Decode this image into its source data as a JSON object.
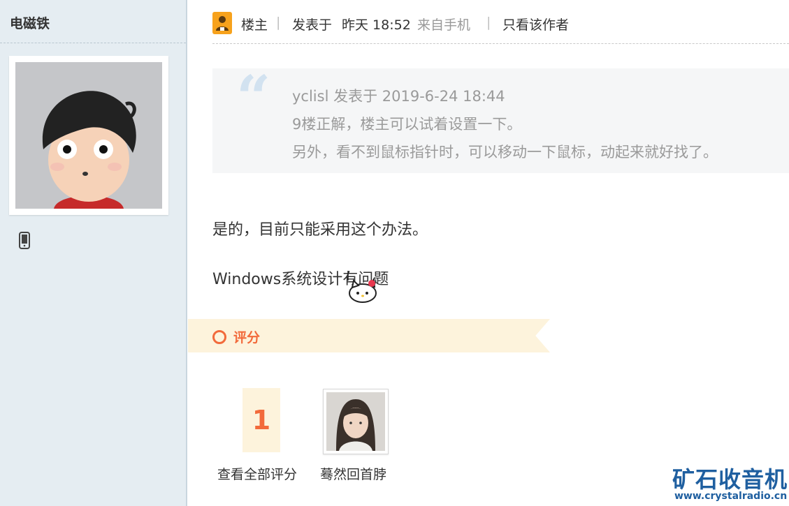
{
  "sidebar": {
    "author_name": "电磁铁",
    "avatar_icon": "cartoon-boy-avatar",
    "device_icon": "mobile-phone-icon"
  },
  "post_header": {
    "host_icon": "user-host-icon",
    "host_label": "楼主",
    "sep1": "|",
    "posted_prefix": "发表于",
    "posted_time": "昨天 18:52",
    "source": "来自手机",
    "sep2": "|",
    "only_author": "只看该作者"
  },
  "quote": {
    "mark": "“",
    "line1": "yclisl 发表于 2019-6-24 18:44",
    "line2": "9楼正解，楼主可以试着设置一下。",
    "line3": "另外，看不到鼠标指针时，可以移动一下鼠标，动起来就好找了。"
  },
  "body": {
    "line1": "是的，目前只能采用这个办法。",
    "line2": "Windows系统设计有问题",
    "sticker_icon": "hello-kitty-cursor-icon"
  },
  "rating": {
    "title": "评分",
    "count": "1",
    "view_all": "查看全部评分",
    "rater_name": "蓦然回首脖",
    "rater_avatar": "girl-photo-avatar"
  },
  "watermark": {
    "title": "矿石收音机",
    "url": "www.crystalradio.cn"
  },
  "colors": {
    "sidebar_bg": "#e5edf2",
    "accent_orange": "#f26a3b",
    "banner_bg": "#fdf3dc",
    "quote_bg": "#f5f6f7",
    "watermark_blue": "#1f5fa0"
  }
}
